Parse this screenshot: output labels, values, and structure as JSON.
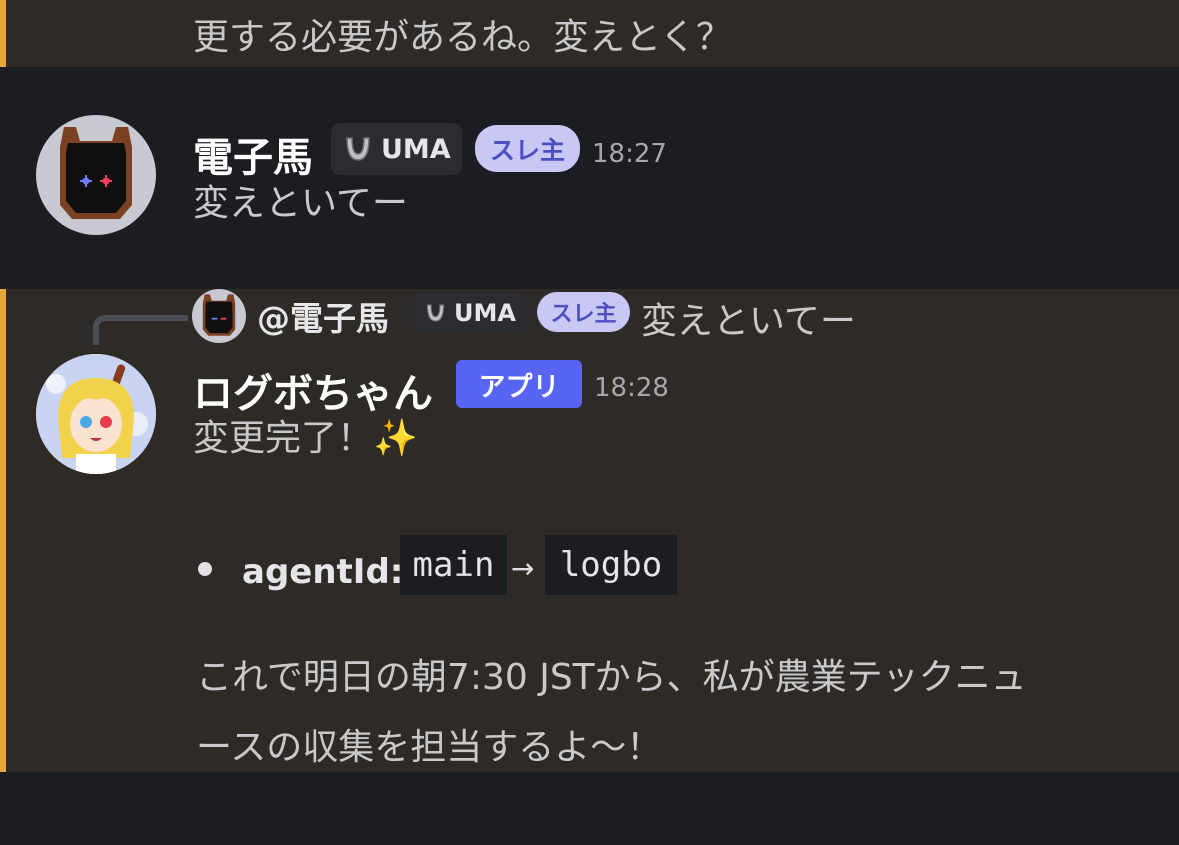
{
  "messages": {
    "prev_text": "更する必要があるね。変えとく？",
    "uma": {
      "username": "電子馬",
      "tag_label": "UMA",
      "role_badge": "スレ主",
      "time": "18:27",
      "text": "変えといてー"
    },
    "reply_preview": {
      "mention": "@電子馬",
      "tag_label": "UMA",
      "role_badge": "スレ主",
      "text": "変えといてー"
    },
    "logbo": {
      "username": "ログボちゃん",
      "app_badge": "アプリ",
      "time": "18:28",
      "line1": "変更完了！✨",
      "bullet_label": "agentId:",
      "code_from": "main",
      "arrow": "→",
      "code_to": "logbo",
      "para_line1": "これで明日の朝7:30 JSTから、私が農業テックニュ",
      "para_line2": "ースの収集を担当するよ〜！"
    }
  },
  "colors": {
    "highlight_bg": "#2e2a25",
    "highlight_bar": "#e8a93a",
    "app_badge": "#5865f2",
    "role_pill": "#c9c8f5"
  },
  "icons": {
    "tag_icon": "guild-tag-horseshoe-icon",
    "sparkles": "sparkles-emoji"
  }
}
